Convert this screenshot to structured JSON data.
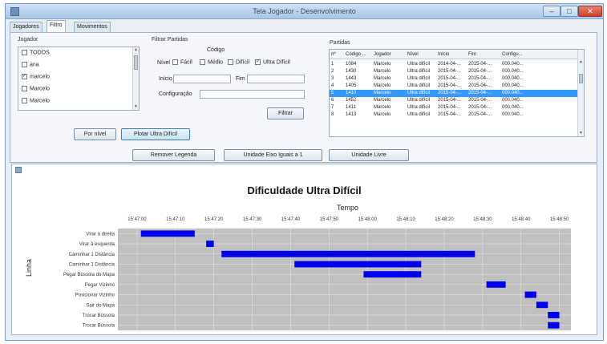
{
  "window": {
    "title": "Tela Jogador - Desenvolvimento",
    "controls": {
      "minimize": "–",
      "maximize": "□",
      "close": "✕"
    }
  },
  "tabs": [
    "Jogadores",
    "Filtro",
    "Movimentos"
  ],
  "left_group": {
    "label": "Jogador",
    "items": [
      {
        "label": "TODOS",
        "checked": false
      },
      {
        "label": "ana",
        "checked": false
      },
      {
        "label": "marcelo",
        "checked": true
      },
      {
        "label": "Marcelo",
        "checked": false
      },
      {
        "label": "Marcelo",
        "checked": false
      }
    ]
  },
  "filter_group": {
    "label": "Filtrar Partidas",
    "codigo_label": "Código",
    "nivel_label": "Nível",
    "levels": [
      {
        "label": "Fácil",
        "checked": false
      },
      {
        "label": "Médio",
        "checked": false
      },
      {
        "label": "Difícil",
        "checked": false
      },
      {
        "label": "Ultra Difícil",
        "checked": true
      }
    ],
    "inicio_label": "Início",
    "fim_label": "Fim",
    "config_label": "Configuração",
    "filter_button": "Filtrar"
  },
  "partidas": {
    "label": "Partidas",
    "columns": [
      "nº",
      "Código ...",
      "Jogador",
      "Nível",
      "Início",
      "Fim",
      "Configu..."
    ],
    "rows": [
      [
        "1",
        "1084",
        "Marcelo",
        "Ultra difícil",
        "2014-04-...",
        "2015-04-...",
        "000.040..."
      ],
      [
        "2",
        "1430",
        "Marcelo",
        "Ultra difícil",
        "2015-04-...",
        "2015-04-...",
        "000.040..."
      ],
      [
        "3",
        "1443",
        "Marcelo",
        "Ultra difícil",
        "2015-04-...",
        "2015-04-...",
        "000.040..."
      ],
      [
        "4",
        "1405",
        "Marcelo",
        "Ultra difícil",
        "2015-04-...",
        "2015-04-...",
        "000.040..."
      ],
      [
        "5",
        "1410",
        "Marcelo",
        "Ultra difícil",
        "2015-04-...",
        "2015-04-...",
        "000.040..."
      ],
      [
        "6",
        "1452",
        "Marcelo",
        "Ultra difícil",
        "2015-04-...",
        "2015-04-...",
        "000.040..."
      ],
      [
        "7",
        "1411",
        "Marcelo",
        "Ultra difícil",
        "2015-04-...",
        "2015-04-...",
        "000.040..."
      ],
      [
        "8",
        "1413",
        "Marcelo",
        "Ultra difícil",
        "2015-04-...",
        "2015-04-...",
        "000.040..."
      ]
    ],
    "selected_row": 4
  },
  "buttons": {
    "por_nivel": "Por nível",
    "plotar": "Plotar Ultra Difícil",
    "remover": "Remover Legenda",
    "unidades_iguais": "Unidade Eixo Iguais a 1",
    "unidade_livre": "Unidade Livre"
  },
  "colors": {
    "bar": "#0000ee",
    "plot_bg": "#c0c0c0",
    "selection": "#3399ff"
  },
  "chart_data": {
    "type": "gantt",
    "title": "Dificuldade Ultra Difícil",
    "xlabel": "Tempo",
    "ylabel": "Linha",
    "x_ticks": [
      "15:47:00",
      "15:47:10",
      "15:47:20",
      "15:47:30",
      "15:47:40",
      "15:47:50",
      "15:48:00",
      "15:48:10",
      "15:48:20",
      "15:48:30",
      "15:48:40",
      "15:48:50"
    ],
    "x_range": [
      "15:46:55",
      "15:48:53"
    ],
    "grid": true,
    "categories": [
      "Virar à direita",
      "Virar à esquerda",
      "Caminhar 1 Distância",
      "Caminhar 1 Distância",
      "Pegar Bússola do Mapa",
      "Pegar Vizinho",
      "Posicionar Vizinho",
      "Sair do Mapa",
      "Trocar Bússola",
      "Trocar Bússola"
    ],
    "bars": [
      {
        "row": 0,
        "start": "15:47:01",
        "end": "15:47:15"
      },
      {
        "row": 1,
        "start": "15:47:18",
        "end": "15:47:20"
      },
      {
        "row": 2,
        "start": "15:47:22",
        "end": "15:48:28"
      },
      {
        "row": 3,
        "start": "15:47:41",
        "end": "15:48:14"
      },
      {
        "row": 4,
        "start": "15:47:59",
        "end": "15:48:14"
      },
      {
        "row": 5,
        "start": "15:48:31",
        "end": "15:48:36"
      },
      {
        "row": 6,
        "start": "15:48:41",
        "end": "15:48:44"
      },
      {
        "row": 7,
        "start": "15:48:44",
        "end": "15:48:47"
      },
      {
        "row": 8,
        "start": "15:48:47",
        "end": "15:48:50"
      },
      {
        "row": 9,
        "start": "15:48:47",
        "end": "15:48:50"
      }
    ]
  }
}
